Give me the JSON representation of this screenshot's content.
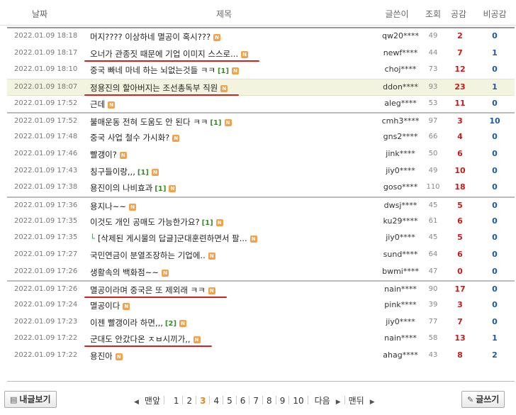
{
  "header": {
    "date": "날짜",
    "title": "제목",
    "writer": "글쓴이",
    "views": "조회",
    "like": "공감",
    "dislike": "비공감"
  },
  "rows": [
    {
      "date": "2022.01.09 18:18",
      "title": "머지???? 이상하네 멸공이 혹시???",
      "comments": "",
      "reply": false,
      "writer": "qw20****",
      "views": "49",
      "like": "2",
      "dislike": "0",
      "highlight": false,
      "sep": false,
      "underline": false
    },
    {
      "date": "2022.01.09 18:17",
      "title": "오너가 관종짓 때문에 기업 이미지 스스로...",
      "comments": "",
      "reply": false,
      "writer": "newf****",
      "views": "44",
      "like": "7",
      "dislike": "1",
      "highlight": false,
      "sep": false,
      "underline": true
    },
    {
      "date": "2022.01.09 18:10",
      "title": "중국 빠네 마네 하는 뇌없는것들 ㅋㅋ",
      "comments": "[1]",
      "reply": false,
      "writer": "choj****",
      "views": "73",
      "like": "12",
      "dislike": "0",
      "highlight": false,
      "sep": false,
      "underline": false
    },
    {
      "date": "2022.01.09 18:07",
      "title": "정용진의 할아버지는 조선총독부 직원",
      "comments": "",
      "reply": false,
      "writer": "ddon****",
      "views": "93",
      "like": "23",
      "dislike": "1",
      "highlight": true,
      "sep": false,
      "underline": true
    },
    {
      "date": "2022.01.09 17:52",
      "title": "근데",
      "comments": "",
      "reply": false,
      "writer": "aleg****",
      "views": "53",
      "like": "11",
      "dislike": "0",
      "highlight": false,
      "sep": false,
      "underline": false
    },
    {
      "date": "2022.01.09 17:52",
      "title": "불매운동 전혀 도움도 안 된다 ㅋㅋ",
      "comments": "[1]",
      "reply": false,
      "writer": "cmh3****",
      "views": "97",
      "like": "3",
      "dislike": "10",
      "highlight": false,
      "sep": true,
      "underline": false
    },
    {
      "date": "2022.01.09 17:48",
      "title": "중국 사업 철수 가시화?",
      "comments": "",
      "reply": false,
      "writer": "gns2****",
      "views": "66",
      "like": "4",
      "dislike": "0",
      "highlight": false,
      "sep": false,
      "underline": false
    },
    {
      "date": "2022.01.09 17:46",
      "title": "빨갱이?",
      "comments": "",
      "reply": false,
      "writer": "jink****",
      "views": "50",
      "like": "6",
      "dislike": "0",
      "highlight": false,
      "sep": false,
      "underline": false
    },
    {
      "date": "2022.01.09 17:43",
      "title": "칭구들이랑,,,",
      "comments": "[1]",
      "reply": false,
      "writer": "jiy0****",
      "views": "49",
      "like": "10",
      "dislike": "0",
      "highlight": false,
      "sep": false,
      "underline": false
    },
    {
      "date": "2022.01.09 17:38",
      "title": "용진이의 나비효과",
      "comments": "[1]",
      "reply": false,
      "writer": "goso****",
      "views": "110",
      "like": "18",
      "dislike": "0",
      "highlight": false,
      "sep": false,
      "underline": false
    },
    {
      "date": "2022.01.09 17:36",
      "title": "용지나~~",
      "comments": "",
      "reply": false,
      "writer": "dwsj****",
      "views": "45",
      "like": "5",
      "dislike": "0",
      "highlight": false,
      "sep": true,
      "underline": false
    },
    {
      "date": "2022.01.09 17:35",
      "title": "이것도 개인 공매도 가능한가요?",
      "comments": "[1]",
      "reply": false,
      "writer": "ku29****",
      "views": "61",
      "like": "6",
      "dislike": "0",
      "highlight": false,
      "sep": false,
      "underline": false
    },
    {
      "date": "2022.01.09 17:35",
      "title": "[삭제된 게시물의 답글]군대훈련하면서 팔...",
      "comments": "",
      "reply": true,
      "writer": "jiy0****",
      "views": "45",
      "like": "5",
      "dislike": "0",
      "highlight": false,
      "sep": false,
      "underline": false
    },
    {
      "date": "2022.01.09 17:27",
      "title": "국민연금이 분열조장하는 기업에..",
      "comments": "",
      "reply": false,
      "writer": "sund****",
      "views": "64",
      "like": "6",
      "dislike": "0",
      "highlight": false,
      "sep": false,
      "underline": false
    },
    {
      "date": "2022.01.09 17:26",
      "title": "생활속의 백화점~~",
      "comments": "",
      "reply": false,
      "writer": "bwmi****",
      "views": "47",
      "like": "0",
      "dislike": "0",
      "highlight": false,
      "sep": false,
      "underline": false
    },
    {
      "date": "2022.01.09 17:26",
      "title": "멸공이라며 중국은 또 제외래 ㅋㅋ",
      "comments": "",
      "reply": false,
      "writer": "nain****",
      "views": "90",
      "like": "17",
      "dislike": "0",
      "highlight": false,
      "sep": true,
      "underline": true
    },
    {
      "date": "2022.01.09 17:24",
      "title": "멸공이다",
      "comments": "",
      "reply": false,
      "writer": "pink****",
      "views": "39",
      "like": "3",
      "dislike": "0",
      "highlight": false,
      "sep": false,
      "underline": false
    },
    {
      "date": "2022.01.09 17:23",
      "title": "이젠 빨갱이라 하면,,,",
      "comments": "[2]",
      "reply": false,
      "writer": "jiy0****",
      "views": "77",
      "like": "7",
      "dislike": "0",
      "highlight": false,
      "sep": false,
      "underline": false
    },
    {
      "date": "2022.01.09 17:22",
      "title": "군대도 안갔다온 ㅈㅂ시끼가,,",
      "comments": "",
      "reply": false,
      "writer": "nain****",
      "views": "58",
      "like": "13",
      "dislike": "1",
      "highlight": false,
      "sep": false,
      "underline": true
    },
    {
      "date": "2022.01.09 17:22",
      "title": "용진아",
      "comments": "",
      "reply": false,
      "writer": "ahag****",
      "views": "43",
      "like": "8",
      "dislike": "2",
      "highlight": false,
      "sep": false,
      "underline": false
    }
  ],
  "new_badge": "N",
  "reply_mark": "└",
  "buttons": {
    "my_posts": "내글보기",
    "write": "글쓰기"
  },
  "pager": {
    "first": "맨앞",
    "pages": [
      "1",
      "2",
      "3",
      "4",
      "5",
      "6",
      "7",
      "8",
      "9",
      "10"
    ],
    "current": "3",
    "next": "다음",
    "last": "맨뒤"
  },
  "colors": {
    "like": "#c71a1a",
    "dislike": "#1a59a8",
    "comment_count": "#3b8a2e",
    "new_badge": "#f3a24b",
    "highlight_row": "#f3f4df",
    "annotation_underline": "#d42020",
    "current_page": "#e8851a"
  },
  "icons": {
    "my_posts_button": "document-icon",
    "write_button": "pencil-icon",
    "new_badge": "new-badge-icon",
    "pager_prev": "chevron-left-icon",
    "pager_next": "chevron-right-icon"
  }
}
